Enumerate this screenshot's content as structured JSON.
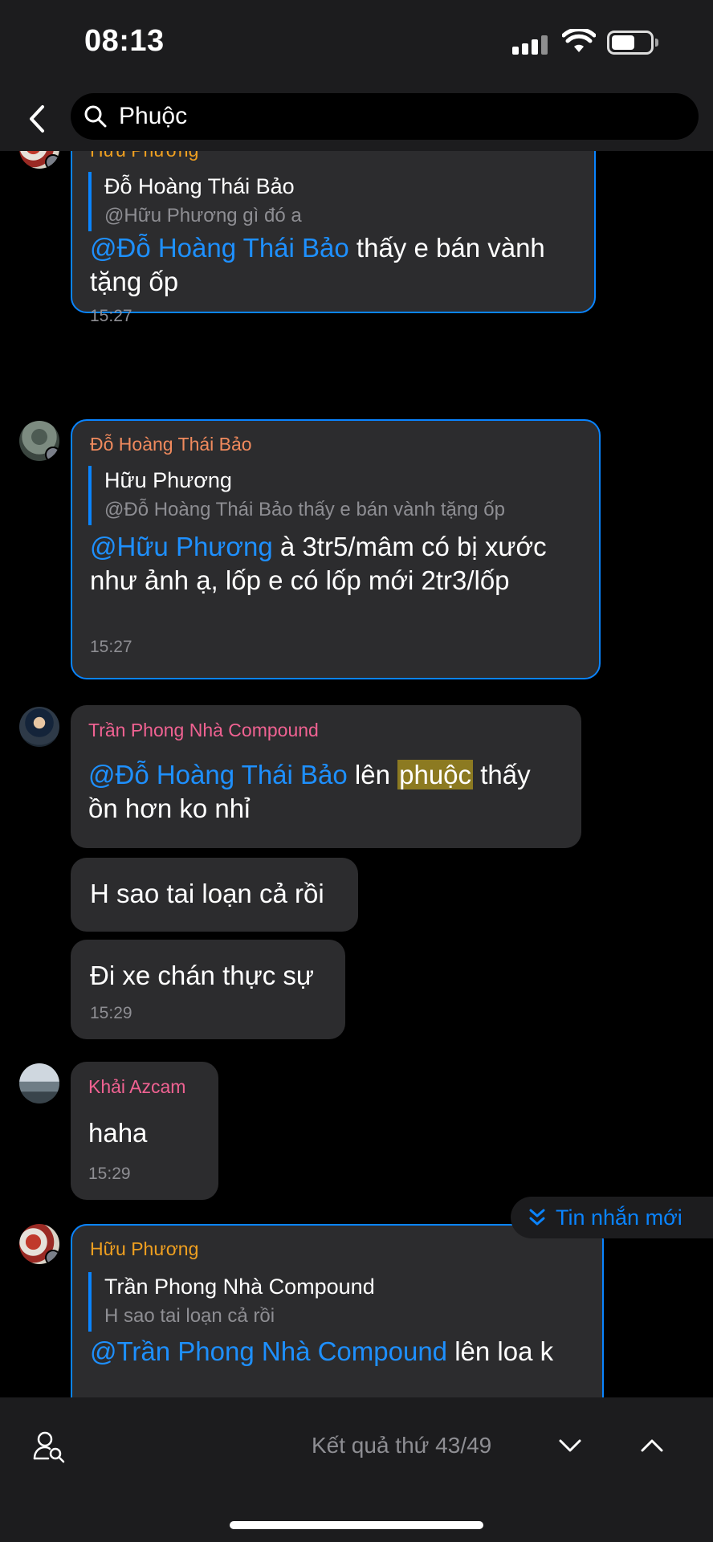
{
  "status_bar": {
    "time": "08:13",
    "battery_level": 0.6
  },
  "header": {
    "search_value": "Phuộc"
  },
  "messages": [
    {
      "sender": "Hữu Phương",
      "quote_author": "Đỗ Hoàng Thái Bảo",
      "quote_text": "@Hữu Phương gì đó a",
      "mention": "@Đỗ Hoàng Thái Bảo",
      "text_line1": " thấy e bán vành",
      "text_line2": "tặng ốp",
      "time": "15:27"
    },
    {
      "sender": "Đỗ Hoàng Thái Bảo",
      "quote_author": "Hữu Phương",
      "quote_text": "@Đỗ Hoàng Thái Bảo thấy e bán vành tặng ốp",
      "mention": "@Hữu Phương",
      "text_line1": " à 3tr5/mâm có bị xước",
      "text_line2": "như ảnh ạ, lốp e có lốp mới 2tr3/lốp",
      "time": "15:27"
    },
    {
      "sender": "Trần Phong Nhà Compound",
      "mention": "@Đỗ Hoàng Thái Bảo",
      "text_before": " lên ",
      "keyword": "phuộc",
      "text_after": " thấy",
      "text_line2": "ồn hơn ko nhỉ"
    },
    {
      "text": "H sao tai loạn cả rồi"
    },
    {
      "text": "Đi xe chán thực sự",
      "time": "15:29"
    },
    {
      "sender": "Khải Azcam",
      "text": "haha",
      "time": "15:29"
    },
    {
      "sender": "Hữu Phương",
      "quote_author": "Trần Phong Nhà Compound",
      "quote_text": "H sao tai loạn cả rồi",
      "mention": "@Trần Phong Nhà Compound",
      "text_line1": " lên loa k"
    }
  ],
  "new_message_pill": "Tin nhắn mới",
  "bottom_bar": {
    "result_text": "Kết quả thứ 43/49"
  }
}
